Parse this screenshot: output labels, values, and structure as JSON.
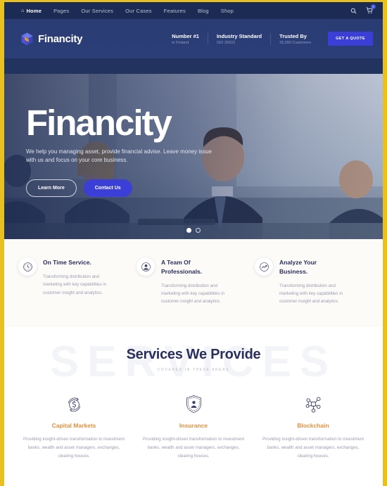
{
  "theme": {
    "border_color": "#e8c120",
    "nav_bg": "#1b2b54",
    "header_bg": "#2c3e77",
    "accent_blue": "#3b3fd8",
    "accent_orange": "#e0903e",
    "heading_navy": "#2a2f5e",
    "body_gray": "#9a9cb0"
  },
  "topnav": {
    "items": [
      {
        "label": "Home",
        "icon": "home-icon",
        "active": true
      },
      {
        "label": "Pages",
        "active": false
      },
      {
        "label": "Our Services",
        "active": false
      },
      {
        "label": "Our Cases",
        "active": false
      },
      {
        "label": "Features",
        "active": false
      },
      {
        "label": "Blog",
        "active": false
      },
      {
        "label": "Shop",
        "active": false
      }
    ],
    "search_icon": "search-icon",
    "cart_icon": "cart-icon",
    "cart_count": "0"
  },
  "header": {
    "brand": "Financity",
    "logo_icon": "cube-logo-icon",
    "stats": [
      {
        "title": "Number #1",
        "sub": "in Finland"
      },
      {
        "title": "Industry Standard",
        "sub": "ISO 20022"
      },
      {
        "title": "Trusted By",
        "sub": "25,000 Customers"
      }
    ],
    "quote_button": "GET A QUOTE"
  },
  "hero": {
    "title": "Financity",
    "subtitle": "We help you managing asset, provide financial advise. Leave money issue with us and focus on your core business.",
    "buttons": {
      "secondary": "Learn More",
      "primary": "Contact Us"
    },
    "slider": {
      "dots": 2,
      "active_index": 0
    }
  },
  "features": [
    {
      "icon": "clock-icon",
      "title": "On Time Service.",
      "text": "Transforming distribution and marketing with key capabilities in customer insight and analytics."
    },
    {
      "icon": "user-circle-icon",
      "title": "A Team Of Professionals.",
      "text": "Transforming distribution and marketing with key capabilities in customer insight and analytics."
    },
    {
      "icon": "chart-growth-icon",
      "title": "Analyze Your Business.",
      "text": "Transforming distribution and marketing with key capabilities in customer insight and analytics."
    }
  ],
  "services": {
    "watermark": "SERVICES",
    "title": "Services We Provide",
    "subtitle": "COVERED IN THESE AREAS",
    "cards": [
      {
        "icon": "dollar-refresh-icon",
        "title": "Capital Markets",
        "text": "Providing insight-driven transformation to investment banks, wealth and asset managers, exchanges, clearing houses."
      },
      {
        "icon": "shield-person-icon",
        "title": "Insurance",
        "text": "Providing insight-driven transformation to investment banks, wealth and asset managers, exchanges, clearing houses."
      },
      {
        "icon": "blockchain-nodes-icon",
        "title": "Blockchain",
        "text": "Providing insight-driven transformation to investment banks, wealth and asset managers, exchanges, clearing houses."
      }
    ]
  }
}
